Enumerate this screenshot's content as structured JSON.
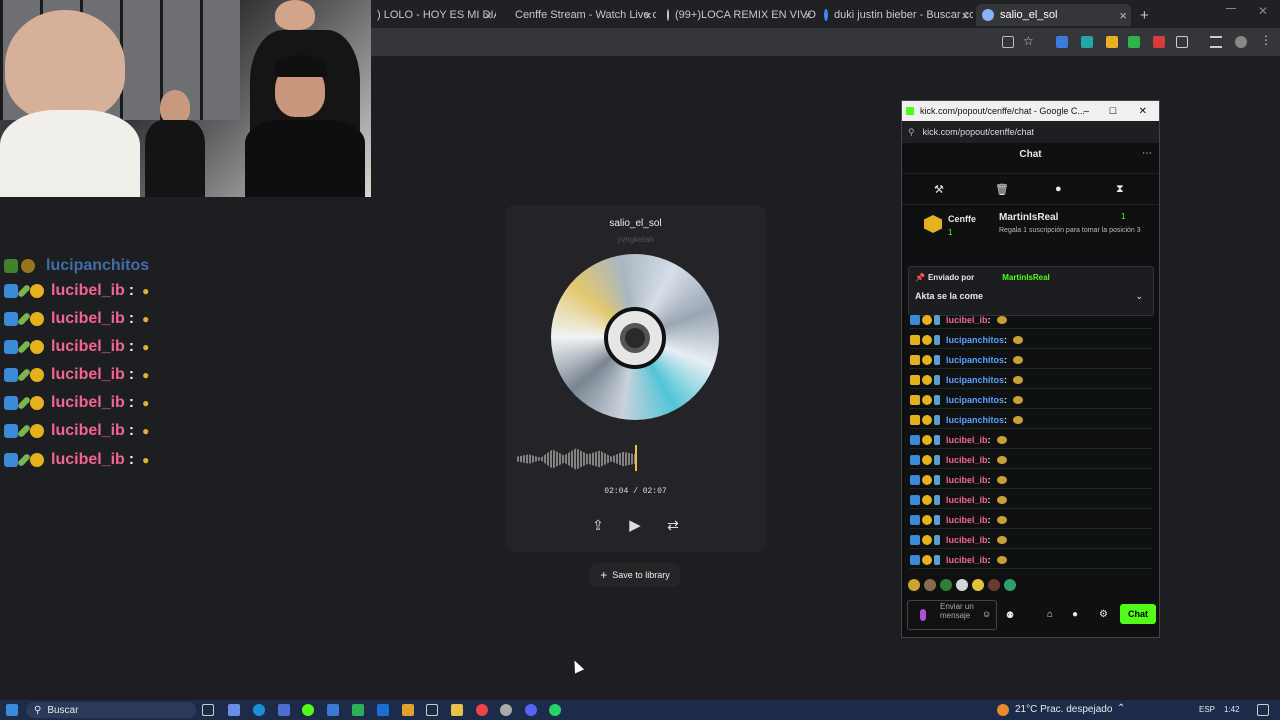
{
  "browser": {
    "tabs": [
      {
        "label": ") LOLO - HOY ES MI DIA (VID",
        "color": "#c4302b"
      },
      {
        "label": "Cenffe Stream - Watch Live on",
        "color": "#53fc18"
      },
      {
        "label": "(99+)LOCA REMIX EN VIVO - B",
        "color": "#222222"
      },
      {
        "label": "duki justin bieber - Buscar con",
        "color": "#4285f4"
      },
      {
        "label": "salio_el_sol",
        "color": "#8ab4f8"
      }
    ],
    "new_tab": "+"
  },
  "left_chat": {
    "truncated": "lucipanchitos",
    "lines": [
      {
        "user": "lucibel_ib",
        "sep": ":"
      },
      {
        "user": "lucibel_ib",
        "sep": ":"
      },
      {
        "user": "lucibel_ib",
        "sep": ":"
      },
      {
        "user": "lucibel_ib",
        "sep": ":"
      },
      {
        "user": "lucibel_ib",
        "sep": ":"
      },
      {
        "user": "lucibel_ib",
        "sep": ":"
      },
      {
        "user": "lucibel_ib",
        "sep": ":"
      }
    ]
  },
  "player": {
    "title": "salio_el_sol",
    "artist": "yvngketah",
    "time": "02:04 / 02:07",
    "progress": 0.98,
    "save_label": "Save to library",
    "share_icon": "share-icon",
    "play_icon": "play-icon",
    "repeat_icon": "repeat-icon"
  },
  "chat_window": {
    "title": "kick.com/popout/cenffe/chat - Google C...",
    "url": "kick.com/popout/cenffe/chat",
    "header": "Chat",
    "channel": "Cenffe",
    "channel_count": "1",
    "gifter": "MartinIsReal",
    "gifter_count": "1",
    "gift_text": "Regala 1 suscripción para tomar la posición 3",
    "pinned_by": "Enviado por",
    "pinned_user": "MartinIsReal",
    "pinned_message": "Akta se la come",
    "messages": [
      {
        "user": "lucibel_ib",
        "color": "#f16590"
      },
      {
        "user": "lucipanchitos",
        "color": "#5aa0ff"
      },
      {
        "user": "lucipanchitos",
        "color": "#5aa0ff"
      },
      {
        "user": "lucipanchitos",
        "color": "#5aa0ff"
      },
      {
        "user": "lucipanchitos",
        "color": "#5aa0ff"
      },
      {
        "user": "lucipanchitos",
        "color": "#5aa0ff"
      },
      {
        "user": "lucibel_ib",
        "color": "#f16590"
      },
      {
        "user": "lucibel_ib",
        "color": "#f16590"
      },
      {
        "user": "lucibel_ib",
        "color": "#f16590"
      },
      {
        "user": "lucibel_ib",
        "color": "#f16590"
      },
      {
        "user": "lucibel_ib",
        "color": "#f16590"
      },
      {
        "user": "lucibel_ib",
        "color": "#f16590"
      },
      {
        "user": "lucibel_ib",
        "color": "#f16590"
      }
    ],
    "input_placeholder": "Enviar un mensaje",
    "send_label": "Chat",
    "accent": "#53fc18"
  },
  "taskbar": {
    "search": "Buscar",
    "weather": "21°C  Prac. despejado",
    "lang": "ESP",
    "time": "1:42"
  }
}
